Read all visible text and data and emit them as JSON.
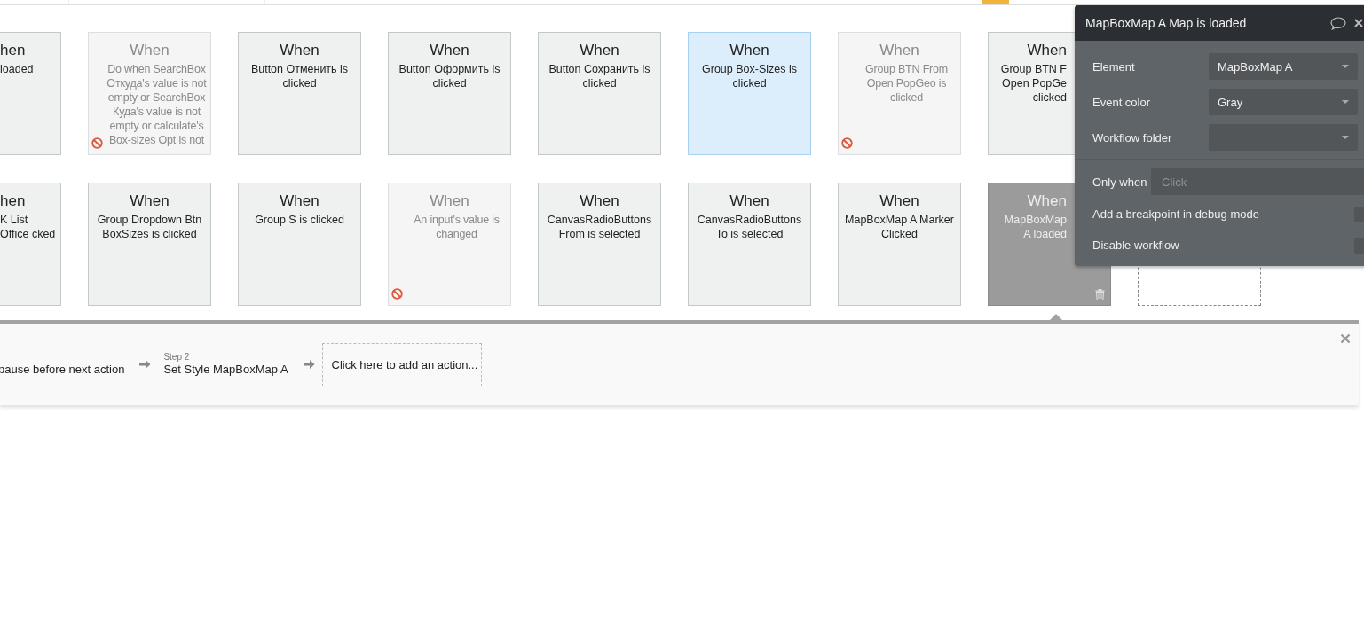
{
  "event_rows": [
    [
      {
        "kind": "event",
        "title": "hen",
        "description": "loaded",
        "disabled": false,
        "selected": false,
        "highlighted": false
      },
      {
        "kind": "event",
        "title": "When",
        "description": "Do when SearchBox Откуда's value is not empty or SearchBox Куда's value is not empty or calculate's Box-sizes Opt is not",
        "disabled": true,
        "selected": false,
        "highlighted": false
      },
      {
        "kind": "event",
        "title": "When",
        "description": "Button Отменить is clicked",
        "disabled": false,
        "selected": false,
        "highlighted": false
      },
      {
        "kind": "event",
        "title": "When",
        "description": "Button Оформить is clicked",
        "disabled": false,
        "selected": false,
        "highlighted": false
      },
      {
        "kind": "event",
        "title": "When",
        "description": "Button Сохранить is clicked",
        "disabled": false,
        "selected": false,
        "highlighted": false
      },
      {
        "kind": "event",
        "title": "When",
        "description": "Group Box-Sizes is clicked",
        "disabled": false,
        "selected": false,
        "highlighted": true
      },
      {
        "kind": "event",
        "title": "When",
        "description": "Group BTN From Open PopGeo is clicked",
        "disabled": true,
        "selected": false,
        "highlighted": false
      },
      {
        "kind": "event",
        "title": "When",
        "description": "Group BTN F Open PopGe clicked",
        "disabled": false,
        "selected": false,
        "highlighted": false
      }
    ],
    [
      {
        "kind": "event",
        "title": "hen",
        "description": "K List Office cked",
        "disabled": false,
        "selected": false,
        "highlighted": false
      },
      {
        "kind": "event",
        "title": "When",
        "description": "Group Dropdown Btn BoxSizes is clicked",
        "disabled": false,
        "selected": false,
        "highlighted": false
      },
      {
        "kind": "event",
        "title": "When",
        "description": "Group S is clicked",
        "disabled": false,
        "selected": false,
        "highlighted": false
      },
      {
        "kind": "event",
        "title": "When",
        "description": "An input's value is changed",
        "disabled": true,
        "selected": false,
        "highlighted": false
      },
      {
        "kind": "event",
        "title": "When",
        "description": "CanvasRadioButtons From is selected",
        "disabled": false,
        "selected": false,
        "highlighted": false
      },
      {
        "kind": "event",
        "title": "When",
        "description": "CanvasRadioButtons To is selected",
        "disabled": false,
        "selected": false,
        "highlighted": false
      },
      {
        "kind": "event",
        "title": "When",
        "description": "MapBoxMap A Marker Clicked",
        "disabled": false,
        "selected": false,
        "highlighted": false
      },
      {
        "kind": "event",
        "title": "When",
        "description": "MapBoxMap A loaded",
        "disabled": false,
        "selected": true,
        "highlighted": false
      },
      {
        "kind": "empty"
      }
    ]
  ],
  "actions": {
    "steps": [
      {
        "name": "pause before next action"
      },
      {
        "label": "Step 2",
        "name": "Set Style MapBoxMap A"
      }
    ],
    "add_action": "Click here to add an action..."
  },
  "panel": {
    "title": "MapBoxMap A Map is loaded",
    "fields": [
      {
        "kind": "select",
        "label": "Element",
        "value": "MapBoxMap A"
      },
      {
        "kind": "select",
        "label": "Event color",
        "value": "Gray"
      },
      {
        "kind": "select",
        "label": "Workflow folder"
      }
    ],
    "only_when": {
      "label": "Only when",
      "placeholder": "Click"
    },
    "options": [
      {
        "label": "Add a breakpoint in debug mode",
        "checked": false
      },
      {
        "label": "Disable workflow",
        "checked": false
      }
    ]
  }
}
